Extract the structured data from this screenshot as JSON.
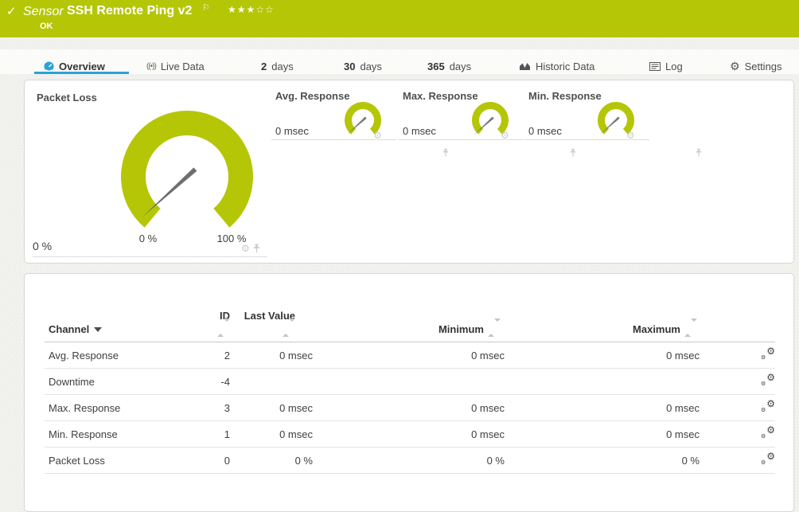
{
  "colors": {
    "brand_green": "#b5c606",
    "accent_blue": "#29a3d8",
    "status_ok_green": "#b5c606"
  },
  "header": {
    "check_icon": "✓",
    "type_label": "Sensor",
    "title": "SSH Remote Ping v2",
    "flag_icon": "⚐",
    "rating_stars_filled": "★★★",
    "rating_stars_empty": "☆☆",
    "status": "OK"
  },
  "tabs": [
    {
      "label": "Overview",
      "active": true
    },
    {
      "label": "Live Data"
    },
    {
      "number": "2",
      "label": "days"
    },
    {
      "number": "30",
      "label": "days"
    },
    {
      "number": "365",
      "label": "days"
    },
    {
      "label": "Historic Data"
    },
    {
      "label": "Log"
    },
    {
      "label": "Settings"
    }
  ],
  "icons": {
    "gear": "⚙",
    "live": "((•))"
  },
  "gauges": {
    "packet_loss": {
      "title": "Packet Loss",
      "value": "0 %",
      "scale_min": "0 %",
      "scale_max": "100 %"
    },
    "avg_response": {
      "title": "Avg. Response",
      "value": "0 msec"
    },
    "max_response": {
      "title": "Max. Response",
      "value": "0 msec"
    },
    "min_response": {
      "title": "Min. Response",
      "value": "0 msec"
    }
  },
  "table": {
    "headers": {
      "channel": "Channel",
      "id": "ID",
      "last_value": "Last Value",
      "minimum": "Minimum",
      "maximum": "Maximum"
    },
    "rows": [
      {
        "channel": "Avg. Response",
        "id": "2",
        "last_value": "0 msec",
        "minimum": "0 msec",
        "maximum": "0 msec"
      },
      {
        "channel": "Downtime",
        "id": "-4",
        "last_value": "",
        "minimum": "",
        "maximum": ""
      },
      {
        "channel": "Max. Response",
        "id": "3",
        "last_value": "0 msec",
        "minimum": "0 msec",
        "maximum": "0 msec"
      },
      {
        "channel": "Min. Response",
        "id": "1",
        "last_value": "0 msec",
        "minimum": "0 msec",
        "maximum": "0 msec"
      },
      {
        "channel": "Packet Loss",
        "id": "0",
        "last_value": "0 %",
        "minimum": "0 %",
        "maximum": "0 %"
      }
    ]
  }
}
